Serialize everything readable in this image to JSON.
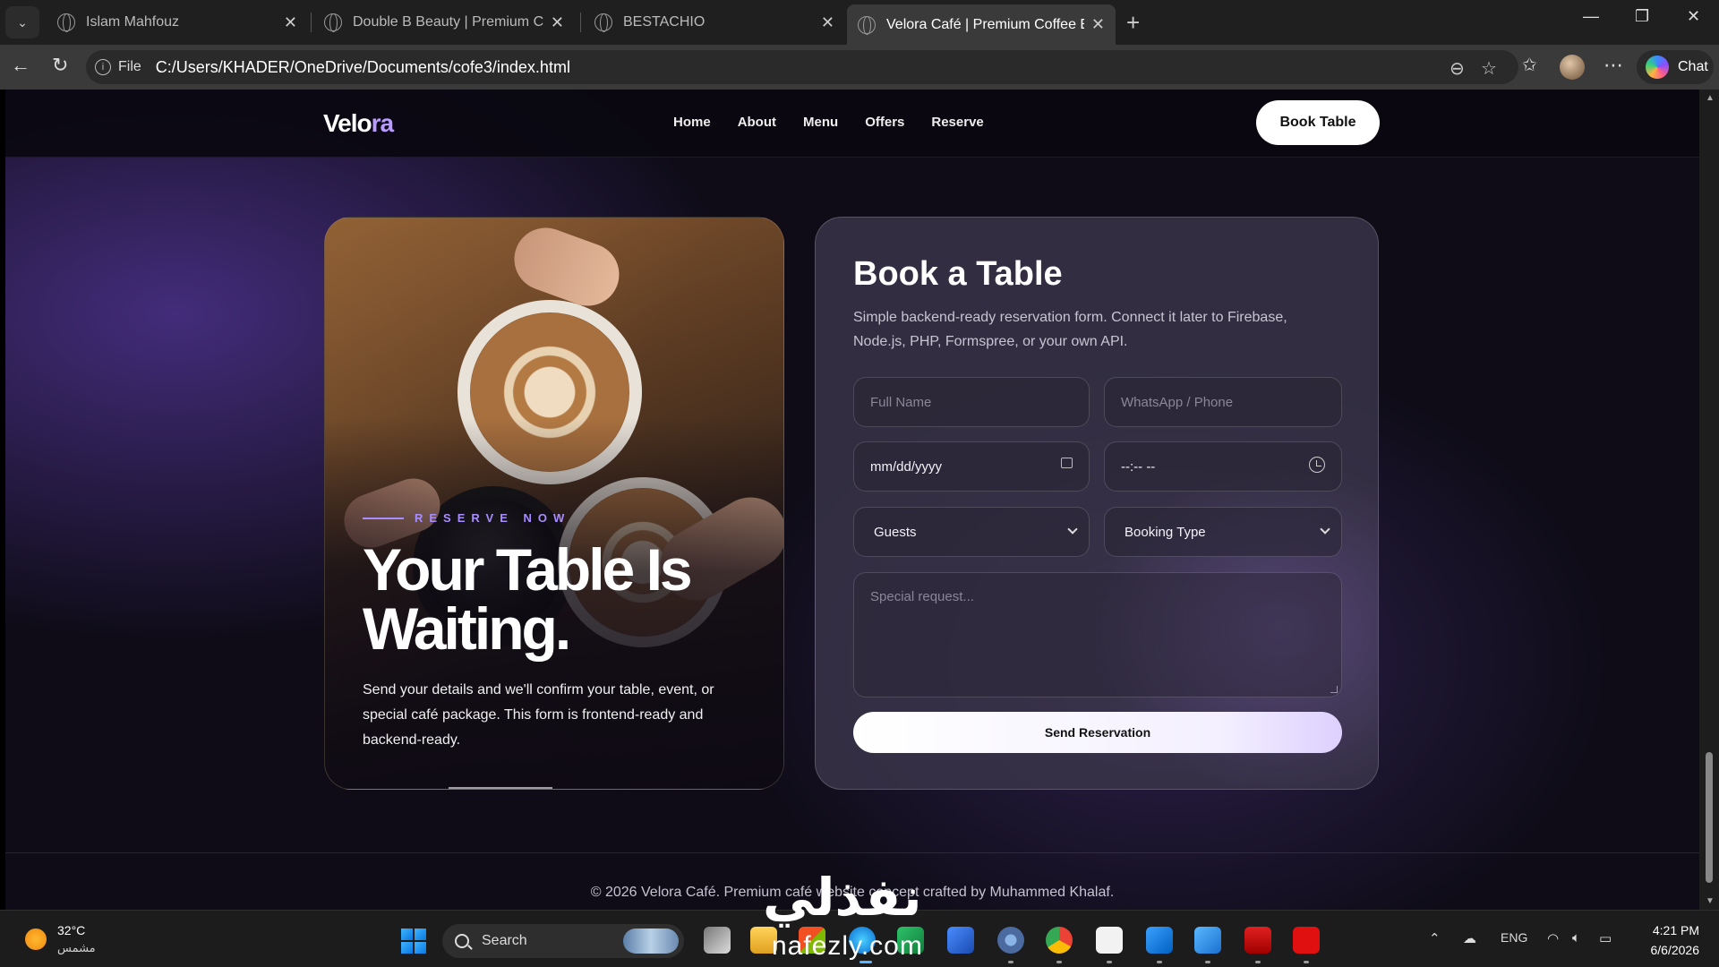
{
  "browser": {
    "tabs": [
      {
        "title": "Islam Mahfouz",
        "active": false
      },
      {
        "title": "Double B Beauty | Premium Cosmetics",
        "active": false
      },
      {
        "title": "BESTACHIO",
        "active": false
      },
      {
        "title": "Velora Café | Premium Coffee Experience",
        "active": true
      }
    ],
    "address": {
      "scheme_label": "File",
      "url": "C:/Users/KHADER/OneDrive/Documents/cofe3/index.html"
    },
    "chat_label": "Chat"
  },
  "site": {
    "logo_main": "Velo",
    "logo_accent": "ra",
    "nav": [
      "Home",
      "About",
      "Menu",
      "Offers",
      "Reserve"
    ],
    "book_button": "Book Table",
    "hero": {
      "eyebrow": "RESERVE NOW",
      "title": "Your Table Is Waiting.",
      "text": "Send your details and we'll confirm your table, event, or special café package. This form is frontend-ready and backend-ready."
    },
    "form": {
      "title": "Book a Table",
      "description": "Simple backend-ready reservation form. Connect it later to Firebase, Node.js, PHP, Formspree, or your own API.",
      "name_placeholder": "Full Name",
      "phone_placeholder": "WhatsApp / Phone",
      "date_value": "mm/dd/yyyy",
      "time_value": "--:-- --",
      "guests_label": "Guests",
      "booking_type_label": "Booking Type",
      "request_placeholder": "Special request...",
      "submit": "Send Reservation"
    },
    "footer": "© 2026 Velora Café. Premium café website concept crafted by Muhammed Khalaf."
  },
  "taskbar": {
    "weather_temp": "32°C",
    "weather_desc": "مشمس",
    "search_label": "Search",
    "language": "ENG",
    "time": "4:21 PM",
    "date": "6/6/2026"
  },
  "watermark": {
    "arabic": "نفذلي",
    "latin": "nafezly.com"
  },
  "colors": {
    "accent": "#b89cff",
    "page_bg": "#0f0c18",
    "card_bg": "#3c374b"
  }
}
